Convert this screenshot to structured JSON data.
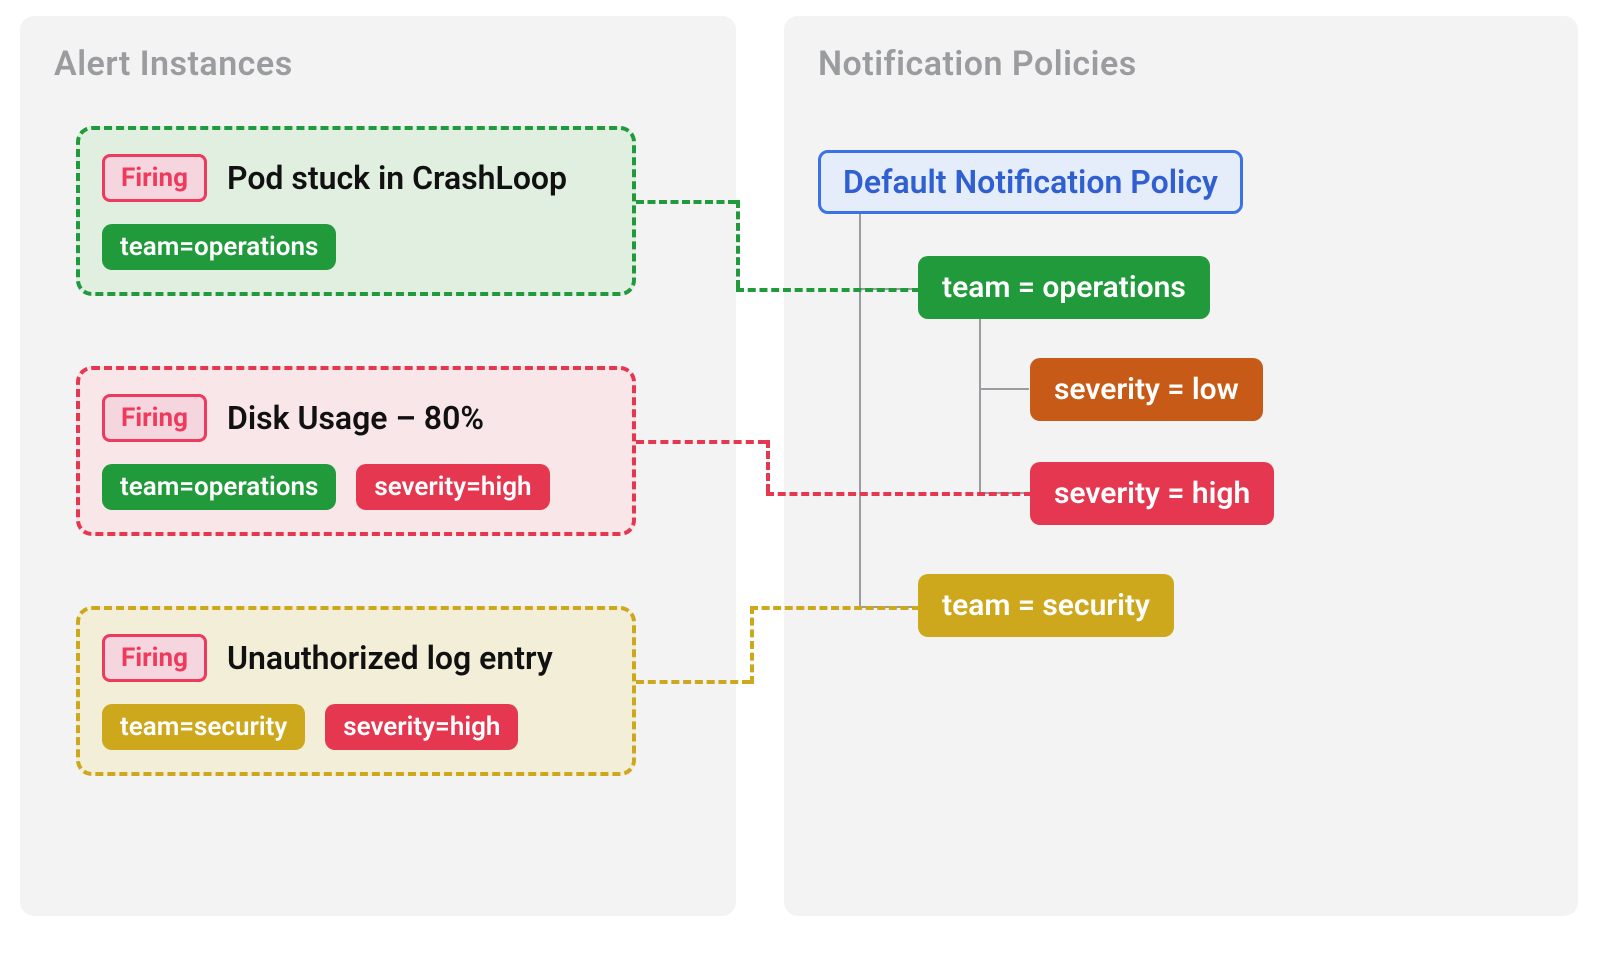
{
  "left_panel_title": "Alert Instances",
  "right_panel_title": "Notification Policies",
  "firing_label": "Firing",
  "alerts": {
    "a0": {
      "title": "Pod stuck in CrashLoop",
      "labels": {
        "l0": "team=operations"
      },
      "color": "green"
    },
    "a1": {
      "title": "Disk Usage – 80%",
      "labels": {
        "l0": "team=operations",
        "l1": "severity=high"
      },
      "color": "red"
    },
    "a2": {
      "title": "Unauthorized log entry",
      "labels": {
        "l0": "team=security",
        "l1": "severity=high"
      },
      "color": "yellow"
    }
  },
  "policies": {
    "root": "Default Notification Policy",
    "p0": "team = operations",
    "p1": "severity = low",
    "p2": "severity = high",
    "p3": "team = security"
  },
  "colors": {
    "green": "#219a3b",
    "red": "#e63751",
    "yellow": "#cda81d",
    "orange": "#c75a16",
    "blue": "#3b72e6"
  }
}
